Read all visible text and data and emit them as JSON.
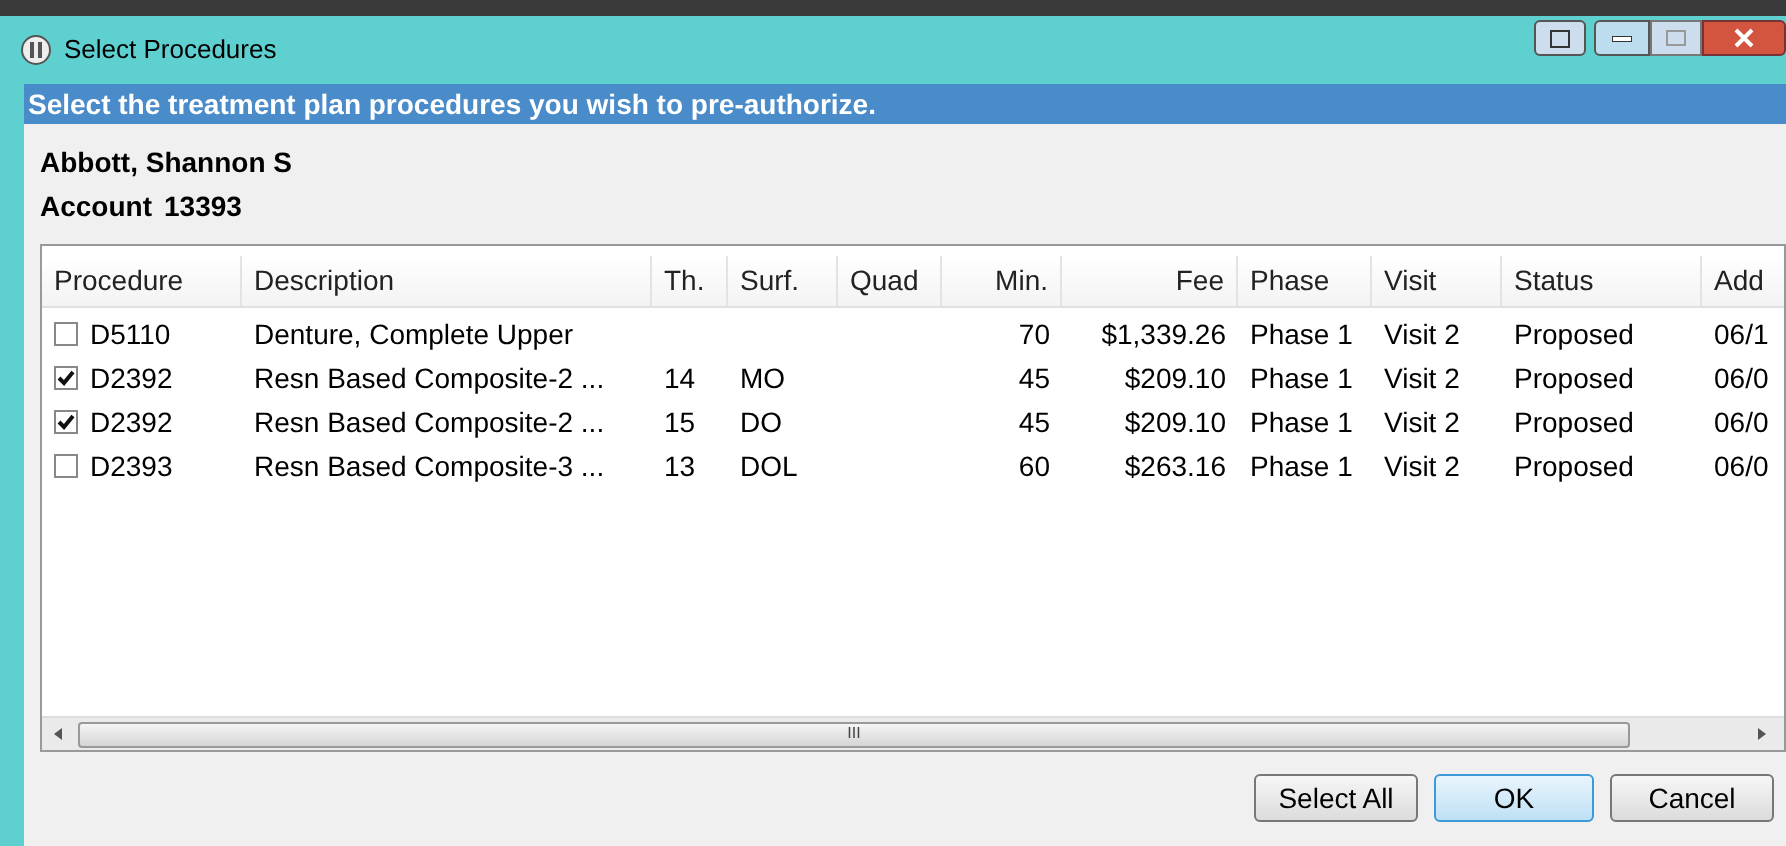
{
  "window": {
    "title": "Select Procedures"
  },
  "banner": "Select the treatment plan procedures you wish to pre-authorize.",
  "patient": {
    "name": "Abbott, Shannon S",
    "account_label": "Account",
    "account": "13393"
  },
  "table": {
    "columns": [
      "Procedure",
      "Description",
      "Th.",
      "Surf.",
      "Quad",
      "Min.",
      "Fee",
      "Phase",
      "Visit",
      "Status",
      "Add"
    ],
    "rows": [
      {
        "checked": false,
        "cells": [
          "D5110",
          "Denture, Complete Upper",
          "",
          "",
          "",
          "70",
          "$1,339.26",
          "Phase 1",
          "Visit 2",
          "Proposed",
          "06/1"
        ]
      },
      {
        "checked": true,
        "cells": [
          "D2392",
          "Resn Based Composite-2 ...",
          "14",
          "MO",
          "",
          "45",
          "$209.10",
          "Phase 1",
          "Visit 2",
          "Proposed",
          "06/0"
        ]
      },
      {
        "checked": true,
        "cells": [
          "D2392",
          "Resn Based Composite-2 ...",
          "15",
          "DO",
          "",
          "45",
          "$209.10",
          "Phase 1",
          "Visit 2",
          "Proposed",
          "06/0"
        ]
      },
      {
        "checked": false,
        "cells": [
          "D2393",
          "Resn Based Composite-3 ...",
          "13",
          "DOL",
          "",
          "60",
          "$263.16",
          "Phase 1",
          "Visit 2",
          "Proposed",
          "06/0"
        ]
      }
    ]
  },
  "scrollbar_grip": "III",
  "buttons": [
    {
      "label": "Select All",
      "default": false
    },
    {
      "label": "OK",
      "default": true
    },
    {
      "label": "Cancel",
      "default": false
    }
  ]
}
